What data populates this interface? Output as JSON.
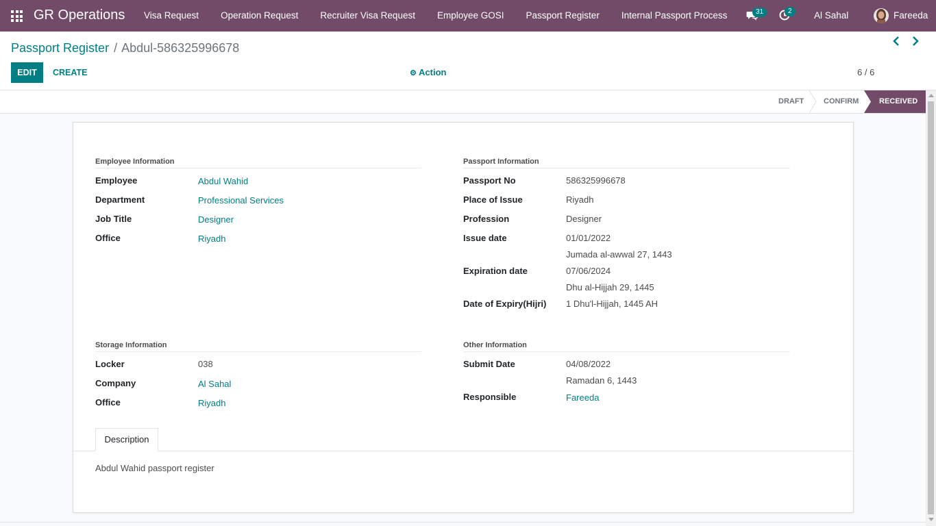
{
  "navbar": {
    "brand": "GR Operations",
    "menu": [
      "Visa Request",
      "Operation Request",
      "Recruiter Visa Request",
      "Employee GOSI",
      "Passport Register",
      "Internal Passport Process"
    ],
    "messages_count": "31",
    "activities_count": "2",
    "company": "Al Sahal",
    "user": "Fareeda"
  },
  "breadcrumb": {
    "parent": "Passport Register",
    "separator": "/",
    "current": "Abdul-586325996678"
  },
  "buttons": {
    "edit": "EDIT",
    "create": "CREATE",
    "action": "Action"
  },
  "pager": {
    "value": "6 / 6"
  },
  "status": {
    "stages": [
      "DRAFT",
      "CONFIRM",
      "RECEIVED"
    ],
    "active": "RECEIVED"
  },
  "employee_info": {
    "title": "Employee Information",
    "fields": [
      {
        "label": "Employee",
        "value": "Abdul Wahid"
      },
      {
        "label": "Department",
        "value": "Professional Services"
      },
      {
        "label": "Job Title",
        "value": "Designer"
      },
      {
        "label": "Office",
        "value": "Riyadh"
      }
    ]
  },
  "passport_info": {
    "title": "Passport Information",
    "passport_no_label": "Passport No",
    "passport_no": "586325996678",
    "place_label": "Place of Issue",
    "place": "Riyadh",
    "profession_label": "Profession",
    "profession": "Designer",
    "issue_label": "Issue date",
    "issue_date": "01/01/2022",
    "issue_hijri": "Jumada al-awwal 27, 1443",
    "expiration_label": "Expiration date",
    "expiration_date": "07/06/2024",
    "expiration_hijri": "Dhu al-Hijjah 29, 1445",
    "expiry_hijri_label": "Date of Expiry(Hijri)",
    "expiry_hijri": "1 Dhu'l-Hijjah, 1445 AH"
  },
  "storage_info": {
    "title": "Storage Information",
    "fields": [
      {
        "label": "Locker",
        "value": "038"
      },
      {
        "label": "Company",
        "value": "Al Sahal"
      },
      {
        "label": "Office",
        "value": "Riyadh"
      }
    ]
  },
  "other_info": {
    "title": "Other Information",
    "submit_label": "Submit Date",
    "submit_date": "04/08/2022",
    "submit_hijri": "Ramadan 6, 1443",
    "responsible_label": "Responsible",
    "responsible": "Fareeda"
  },
  "tabs": {
    "description": "Description"
  },
  "description_text": "Abdul Wahid passport register",
  "colors": {
    "brand": "#714b67",
    "accent": "#017e84"
  }
}
